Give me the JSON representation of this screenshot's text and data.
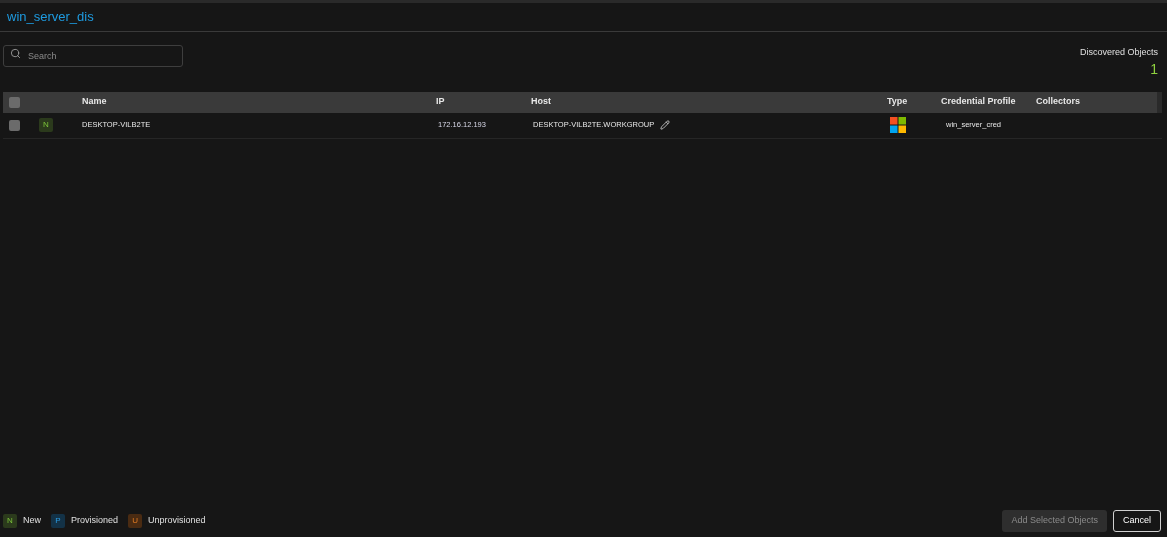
{
  "title": "win_server_dis",
  "search": {
    "placeholder": "Search"
  },
  "summary": {
    "label": "Discovered Objects",
    "count": "1"
  },
  "table": {
    "select_all": {
      "checked": false
    },
    "columns": [
      "Name",
      "IP",
      "Host",
      "Type",
      "Credential Profile",
      "Collectors"
    ],
    "rows": [
      {
        "checked": false,
        "status": {
          "kind": "new",
          "letter": "N"
        },
        "name": "DESKTOP-VILB2TE",
        "ip": "172.16.12.193",
        "host": "DESKTOP-VILB2TE.WORKGROUP",
        "kind": "windows",
        "credential_profile": "win_server_cred"
      }
    ]
  },
  "legend": [
    {
      "kind": "new",
      "letter": "N",
      "label": "New"
    },
    {
      "kind": "provisioned",
      "letter": "P",
      "label": "Provisioned"
    },
    {
      "kind": "unprovisioned",
      "letter": "U",
      "label": "Unprovisioned"
    }
  ],
  "buttons": [
    {
      "label": "Add Selected Objects",
      "disabled": true
    },
    {
      "label": "Cancel",
      "disabled": false
    }
  ]
}
